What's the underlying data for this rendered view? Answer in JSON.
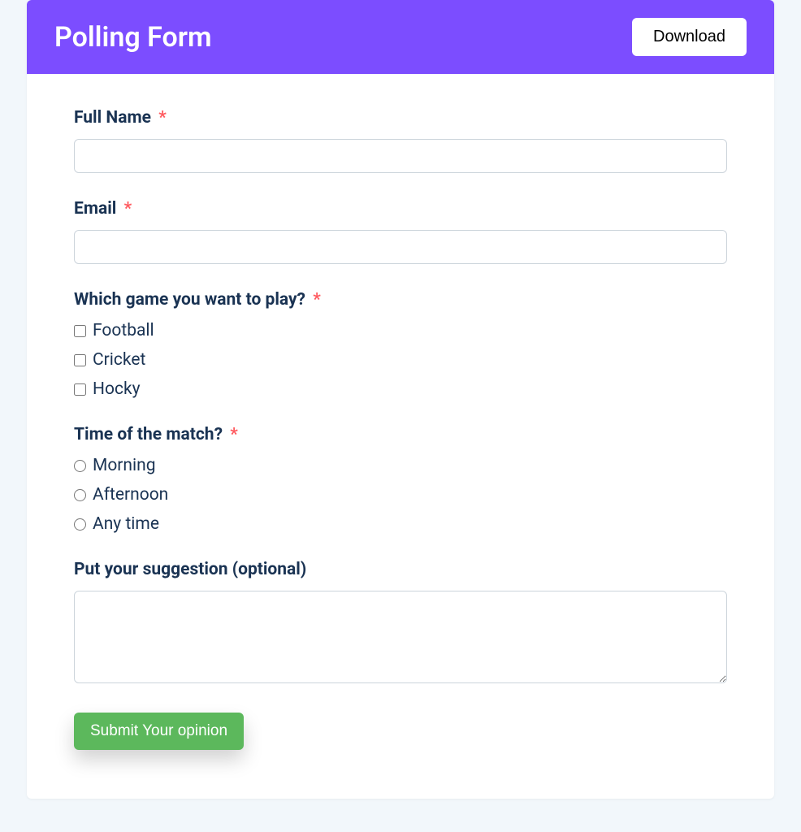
{
  "header": {
    "title": "Polling Form",
    "download_label": "Download"
  },
  "fields": {
    "full_name": {
      "label": "Full Name",
      "required": "*"
    },
    "email": {
      "label": "Email",
      "required": "*"
    },
    "game": {
      "label": "Which game you want to play?",
      "required": "*",
      "options": [
        "Football",
        "Cricket",
        "Hocky"
      ]
    },
    "time": {
      "label": "Time of the match?",
      "required": "*",
      "options": [
        "Morning",
        "Afternoon",
        "Any time"
      ]
    },
    "suggestion": {
      "label": "Put your suggestion (optional)"
    }
  },
  "submit_label": "Submit Your opinion",
  "colors": {
    "header_bg": "#7c4dff",
    "label_text": "#1a3353",
    "required": "#ff5a5f",
    "submit_bg": "#5cb85c"
  }
}
